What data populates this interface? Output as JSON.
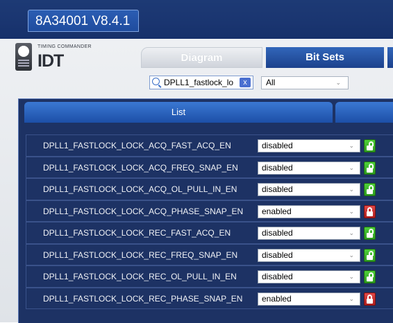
{
  "window": {
    "title": "8A34001 V8.4.1"
  },
  "logo": {
    "small_text": "TIMING COMMANDER",
    "main_text": "IDT"
  },
  "tabs": [
    {
      "label": "Diagram",
      "active": false
    },
    {
      "label": "Bit Sets",
      "active": true
    }
  ],
  "search": {
    "value": "DPLL1_fastlock_lo",
    "clear_label": "x",
    "icon": "search-icon"
  },
  "filter": {
    "selected": "All"
  },
  "list_tab": {
    "label": "List"
  },
  "rows": [
    {
      "label": "DPLL1_FASTLOCK_LOCK_ACQ_FAST_ACQ_EN",
      "value": "disabled",
      "lock": "unlocked"
    },
    {
      "label": "DPLL1_FASTLOCK_LOCK_ACQ_FREQ_SNAP_EN",
      "value": "disabled",
      "lock": "unlocked"
    },
    {
      "label": "DPLL1_FASTLOCK_LOCK_ACQ_OL_PULL_IN_EN",
      "value": "disabled",
      "lock": "unlocked"
    },
    {
      "label": "DPLL1_FASTLOCK_LOCK_ACQ_PHASE_SNAP_EN",
      "value": "enabled",
      "lock": "locked"
    },
    {
      "label": "DPLL1_FASTLOCK_LOCK_REC_FAST_ACQ_EN",
      "value": "disabled",
      "lock": "unlocked"
    },
    {
      "label": "DPLL1_FASTLOCK_LOCK_REC_FREQ_SNAP_EN",
      "value": "disabled",
      "lock": "unlocked"
    },
    {
      "label": "DPLL1_FASTLOCK_LOCK_REC_OL_PULL_IN_EN",
      "value": "disabled",
      "lock": "unlocked"
    },
    {
      "label": "DPLL1_FASTLOCK_LOCK_REC_PHASE_SNAP_EN",
      "value": "enabled",
      "lock": "locked"
    }
  ],
  "colors": {
    "titlebar": "#1a3570",
    "panel": "#1d3264",
    "tab_active": "#1b418c",
    "lock_unlocked": "#2e9c1f",
    "lock_locked": "#b01f1f"
  }
}
